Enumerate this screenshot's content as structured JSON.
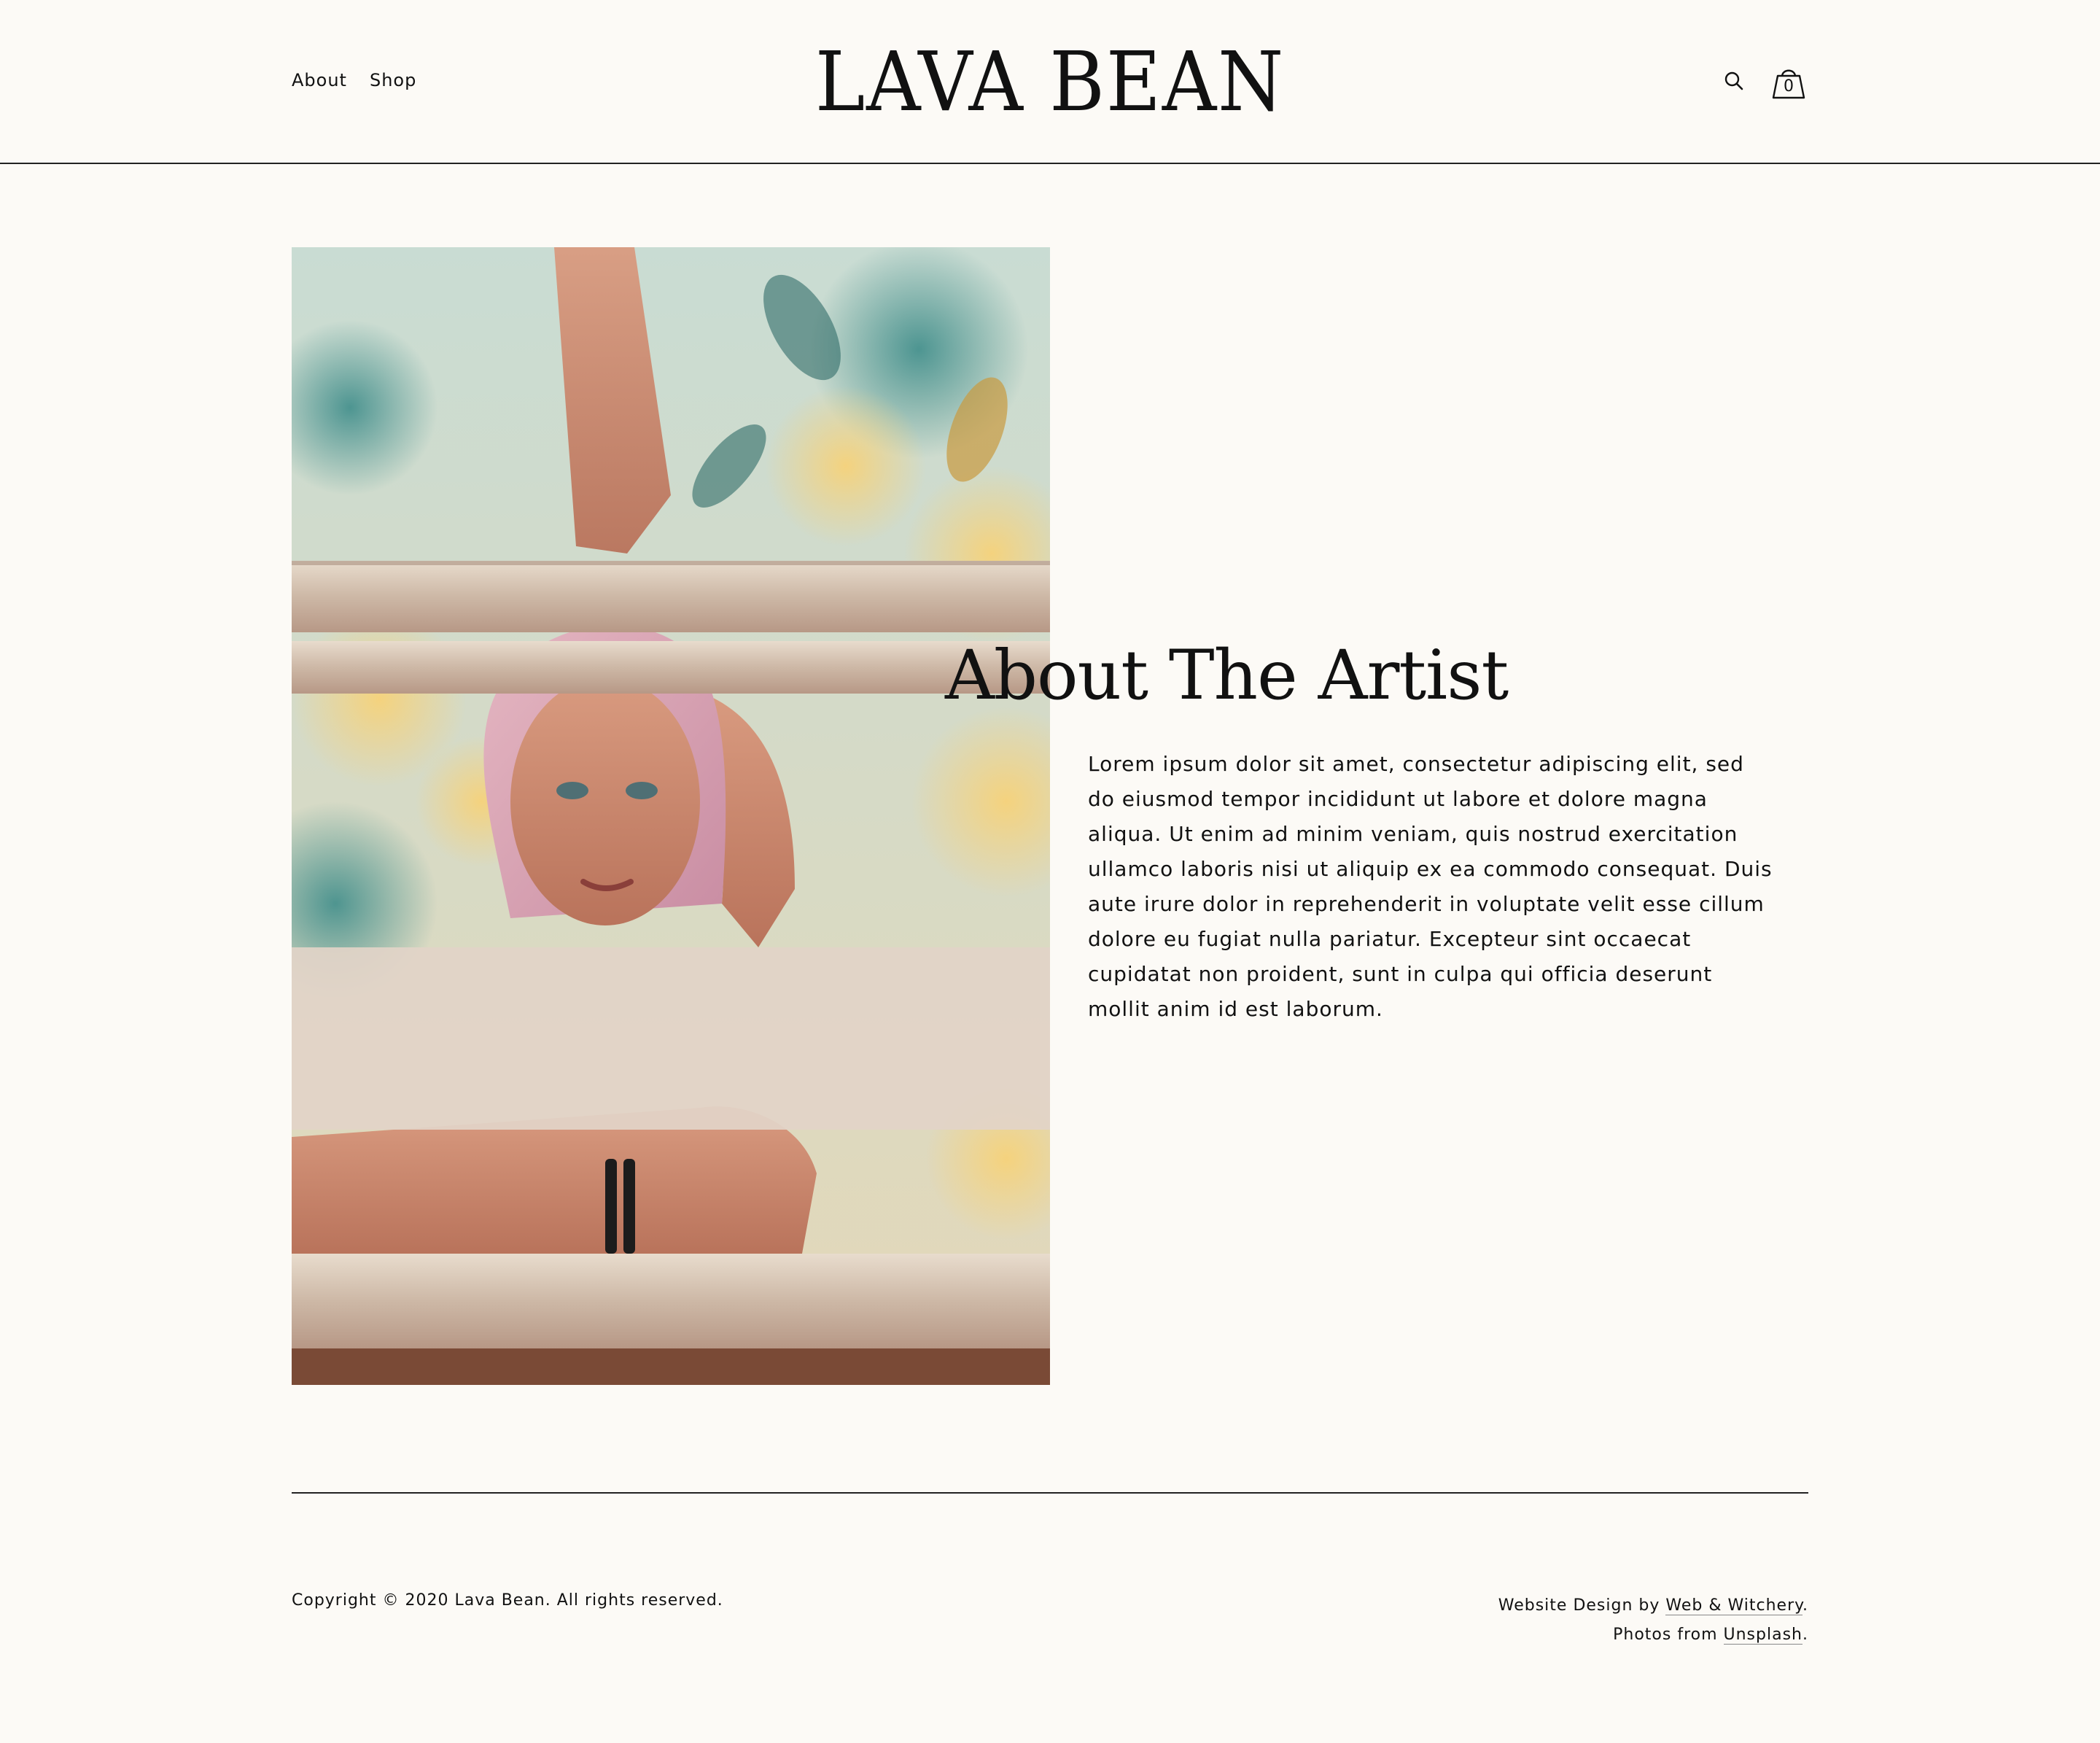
{
  "header": {
    "nav": [
      {
        "label": "About"
      },
      {
        "label": "Shop"
      }
    ],
    "logo": "LAVA BEAN",
    "search_icon": "search-icon",
    "cart_icon": "shopping-bag-icon",
    "cart_count": "0"
  },
  "main": {
    "photo_alt": "Portrait of a woman with pink hair behind painted metal bars",
    "title": "About The Artist",
    "body": "Lorem ipsum dolor sit amet, consectetur adipiscing elit, sed do eiusmod tempor incididunt ut labore et dolore magna aliqua. Ut enim ad minim veniam, quis nostrud exercitation ullamco laboris nisi ut aliquip ex ea commodo consequat. Duis aute irure dolor in reprehenderit in voluptate velit esse cillum dolore eu fugiat nulla pariatur. Excepteur sint occaecat cupidatat non proident, sunt in culpa qui officia deserunt mollit anim id est laborum."
  },
  "footer": {
    "copyright": "Copyright © 2020 Lava Bean. All rights reserved.",
    "design_prefix": "Website Design by ",
    "design_link": "Web & Witchery",
    "design_suffix": ".",
    "photos_prefix": "Photos from ",
    "photos_link": "Unsplash",
    "photos_suffix": "."
  },
  "colors": {
    "background": "#fcfaf6",
    "text": "#111111"
  }
}
